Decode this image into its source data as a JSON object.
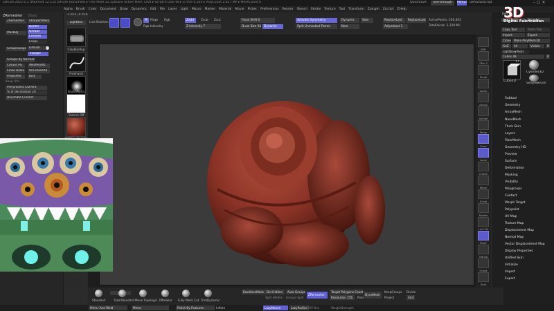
{
  "titlebar": {
    "title": "ZBrush 2022.0.3 [MEXTEN 12.5.2] ZBrush Document ▸ Free Mem 22.326GB ▸ Active Mem 7204 ▸ Scratch Disk 48 ▸ ZTime 0.305 ▸ PolyCount 2.817 MP ▸ MeshCount 6",
    "quicksave": "QuickSave",
    "see_through": "See-through",
    "menus": "Menus",
    "default_zscript": "DefaultZScript"
  },
  "menubar": [
    "Alpha",
    "Brush",
    "Color",
    "Document",
    "Draw",
    "Dynamics",
    "Edit",
    "File",
    "Layer",
    "Light",
    "Macro",
    "Marker",
    "Material",
    "Movie",
    "Picker",
    "Preferences",
    "Render",
    "Stencil",
    "Stroke",
    "Texture",
    "Tool",
    "Transform",
    "Zplugin",
    "Zscript",
    "ZHelp"
  ],
  "left_panel": {
    "title": "ZRemesher",
    "zremesher_tab": "ZTools",
    "buttons": [
      "ZRemesher",
      "SharpenMask",
      "Border",
      "Groups",
      "Creases",
      "Loops"
    ],
    "groups_loops": "GroupsLoops",
    "gpolish": "GPolish",
    "triangle": "Triangle",
    "groups_by_normals": "Groups By Normals",
    "maskby": "MaskBy",
    "crease_pg": "Crease PG",
    "weld_points": "WeldPoints",
    "close_holes": "Close Holes",
    "uncrease_all": "UnCreaseAll",
    "project_all": "ProjectAll",
    "dist": "Dist",
    "keep_uvs": "Keep UVs",
    "preprocess_current": "Pre-process Current",
    "pct_decimation": "% of decimation 20",
    "decimate_current": "Decimate Current",
    "coords": "-2.922,-0.918,-0.466"
  },
  "brush_column": {
    "lightbox": "LightBox",
    "brushes": [
      "ClayBuildup",
      "Freehand",
      "BrushAlpha",
      "Texture Off",
      "MatCap Red 01"
    ]
  },
  "top_toolbar": {
    "live_boolean": "Live Boolean",
    "mrgb": "Mrgb",
    "rgb": "Rgb",
    "m": "M",
    "zadd": "Zadd",
    "zsub": "Zsub",
    "zcut": "Zcut",
    "z_intensity": "Z Intensity 7",
    "rgb_intensity": "Rgb Intensity",
    "focal_shift": "Focal Shift 0",
    "draw_size": "Draw Size 64",
    "dynamic": "Dynamic",
    "activate_symmetry": "Activate Symmetry",
    "split_unmasked": "Split Unmasked Points",
    "dynamic2": "Dynamic",
    "solo": "Solo",
    "new": "New",
    "replace_last": "ReplaceLast",
    "replace_last_rel": "ReplaceLastRel",
    "adjust_last": "AdjustLast 1",
    "active_points": "ActivePoints: 206,463",
    "total_points": "TotalPoints: 3.320 Mil"
  },
  "right_strip": [
    "BPR",
    "SPix 3",
    "Scroll",
    "Zoom",
    "Actual",
    "AAHalf",
    "Persp",
    "Floor",
    "Local",
    "Frame",
    "Move",
    "Scale",
    "Rotate",
    "Line Fill",
    "PolyF",
    "Transp",
    "Ghost",
    "Solo",
    "Xpose"
  ],
  "tool_palette": {
    "header": "Tool",
    "logo_top": "3D",
    "logo_bottom": "Digital Fabrication",
    "load_tool": "Load Tool",
    "save_as": "Save As",
    "copy_tool": "Copy Tool",
    "paste_tool": "Paste Tool",
    "import": "Import",
    "export": "Export",
    "clone": "Clone",
    "make_polymesh": "Make PolyMesh3D",
    "goz": "GoZ",
    "all": "All",
    "visible": "Visible",
    "r": "R",
    "lightbox_tools": "Lightbox▸Tools",
    "cubes_label": "Cubes  48",
    "r2": "R",
    "tool_count": "17",
    "tool_items": [
      "Cube3D",
      "Cylinder3D",
      "SimpleBrush"
    ],
    "subtools": [
      "Subtool",
      "Geometry",
      "ArrayMesh",
      "NanoMesh",
      "Thick Skin",
      "Layers",
      "FiberMesh",
      "Geometry HD",
      "Preview",
      "Surface",
      "Deformation",
      "Masking",
      "Visibility",
      "Polygroups",
      "Contact",
      "Morph Target",
      "Polypaint",
      "UV Map",
      "Texture Map",
      "Displacement Map",
      "Normal Map",
      "Vector Displacement Map",
      "Display Properties",
      "Unified Skin",
      "Initialize",
      "Import",
      "Export"
    ]
  },
  "bottom_bar": {
    "brushes": [
      "Standard",
      "DamStandard",
      "Move Topologic",
      "ZModeler",
      "hPolish",
      "TrimDynamic"
    ],
    "backface_mask": "BackfaceMask",
    "auto_groups": "Auto Groups",
    "del_hidden": "Del Hidden",
    "split_hidden": "Split Hidden",
    "groups_split": "Groups Split",
    "zremesher": "ZRemesher",
    "target_polygons": "Target Polygons Count 5",
    "resolution": "Resolution 256",
    "polish": "Polish",
    "dynamesh": "DynaMesh",
    "keep_groups": "KeepGroups",
    "divide": "Divide",
    "smt": "Smt",
    "project": "Project",
    "mirror_and_weld": "Mirror And Weld",
    "mirror": "Mirror",
    "polish_by_features": "Polish By Features",
    "inflate": "Inflate",
    "lazy_mouse": "LazyMouse",
    "lazy_radius": "LazyRadius 1",
    "uv_box": "UV Box",
    "weight_strength": "WeightStrength",
    "fully_mesh_cut": "Fully Mesh Cut"
  },
  "colors": {
    "accent": "#6565d6",
    "model": "#8a3226",
    "canvas": "#3b3b3b"
  }
}
